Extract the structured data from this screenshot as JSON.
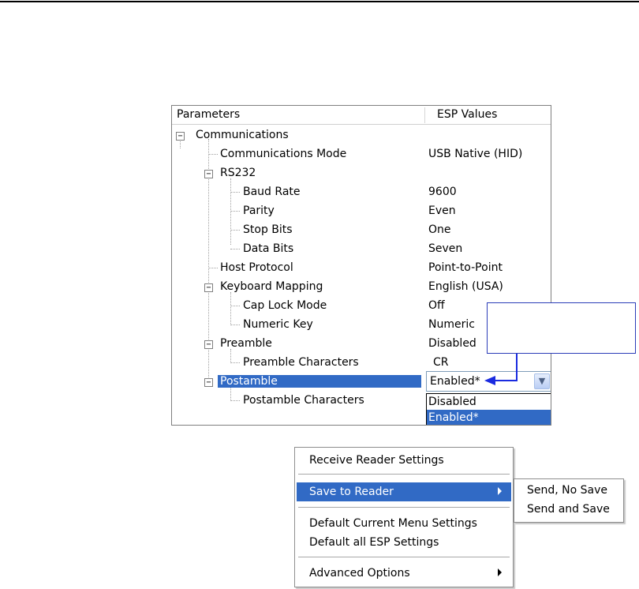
{
  "panel": {
    "header_parameters": "Parameters",
    "header_values": "ESP Values"
  },
  "tree": {
    "communications": {
      "label": "Communications",
      "expander": "−"
    },
    "communications_mode": {
      "label": "Communications Mode",
      "value": "USB Native (HID)"
    },
    "rs232": {
      "label": "RS232",
      "expander": "−"
    },
    "baud_rate": {
      "label": "Baud Rate",
      "value": "9600"
    },
    "parity": {
      "label": "Parity",
      "value": "Even"
    },
    "stop_bits": {
      "label": "Stop Bits",
      "value": "One"
    },
    "data_bits": {
      "label": "Data Bits",
      "value": "Seven"
    },
    "host_protocol": {
      "label": "Host Protocol",
      "value": "Point-to-Point"
    },
    "keyboard_mapping": {
      "label": "Keyboard Mapping",
      "value": "English (USA)",
      "expander": "−"
    },
    "cap_lock_mode": {
      "label": "Cap Lock Mode",
      "value": "Off"
    },
    "numeric_key": {
      "label": "Numeric Key",
      "value": "Numeric"
    },
    "preamble": {
      "label": "Preamble",
      "value": "Disabled",
      "expander": "−"
    },
    "preamble_characters": {
      "label": "Preamble Characters",
      "value": "CR"
    },
    "postamble": {
      "label": "Postamble",
      "expander": "−"
    },
    "postamble_characters": {
      "label": "Postamble Characters"
    }
  },
  "postamble_combo": {
    "value": "Enabled*",
    "options": [
      "Disabled",
      "Enabled*"
    ]
  },
  "context_menu": {
    "receive": "Receive Reader Settings",
    "save_to_reader": "Save to Reader",
    "default_current": "Default Current Menu Settings",
    "default_all": "Default all ESP Settings",
    "advanced": "Advanced Options"
  },
  "submenu": {
    "send_no_save": "Send, No Save",
    "send_and_save": "Send and Save"
  },
  "colors": {
    "selection": "#316ac5",
    "callout_border": "#2a3cb8",
    "arrow": "#1a2be0"
  }
}
